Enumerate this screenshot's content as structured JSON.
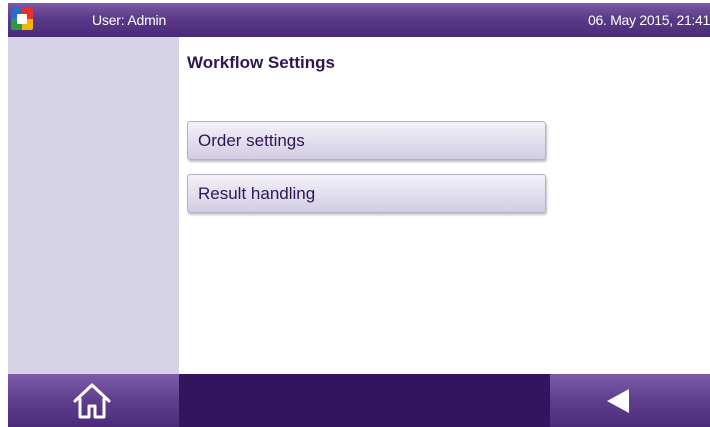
{
  "header": {
    "user": "User: Admin",
    "datetime": "06. May 2015, 21:41"
  },
  "page": {
    "title": "Workflow Settings"
  },
  "menu": {
    "items": [
      {
        "label": "Order settings"
      },
      {
        "label": "Result handling"
      }
    ]
  },
  "footer": {
    "home_icon": "home-icon",
    "back_icon": "back-arrow-icon"
  },
  "colors": {
    "accent": "#5b3a8a",
    "sidebar": "#d6d2e6",
    "footer": "#34145e",
    "text": "#2e1656"
  }
}
